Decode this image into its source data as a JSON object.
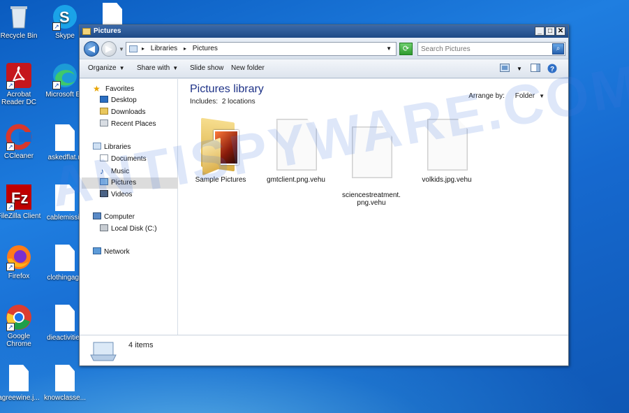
{
  "window": {
    "title": "Pictures",
    "minimize": "_",
    "maximize": "□",
    "close": "✕"
  },
  "address": {
    "crumbs": [
      "Libraries",
      "Pictures"
    ],
    "search_placeholder": "Search Pictures"
  },
  "toolbar": {
    "organize": "Organize",
    "share_with": "Share with",
    "slide_show": "Slide show",
    "new_folder": "New folder"
  },
  "navpane": {
    "favorites": "Favorites",
    "desktop": "Desktop",
    "downloads": "Downloads",
    "recent_places": "Recent Places",
    "libraries": "Libraries",
    "documents": "Documents",
    "music": "Music",
    "pictures": "Pictures",
    "videos": "Videos",
    "computer": "Computer",
    "local_disk": "Local Disk (C:)",
    "network": "Network"
  },
  "content": {
    "title": "Pictures library",
    "includes_label": "Includes:",
    "includes_link": "2 locations",
    "arrange_label": "Arrange by:",
    "arrange_value": "Folder",
    "items": [
      {
        "name": "Sample Pictures",
        "type": "folder"
      },
      {
        "name": "gmtclient.png.vehu",
        "type": "file"
      },
      {
        "name": "sciencestreatment.\npng.vehu",
        "type": "file"
      },
      {
        "name": "volkids.jpg.vehu",
        "type": "file"
      }
    ]
  },
  "details": {
    "count": "4 items"
  },
  "desktop_icons": [
    {
      "label": "Recycle Bin",
      "icon": "recycle-bin-icon"
    },
    {
      "label": "Skype",
      "icon": "skype-icon"
    },
    {
      "label": "Acrobat Reader DC",
      "icon": "acrobat-icon"
    },
    {
      "label": "Microsoft Ed",
      "icon": "edge-icon"
    },
    {
      "label": "CCleaner",
      "icon": "ccleaner-icon"
    },
    {
      "label": "askedflat.rt",
      "icon": "document-icon"
    },
    {
      "label": "FileZilla Client",
      "icon": "filezilla-icon"
    },
    {
      "label": "cablemissio",
      "icon": "document-icon"
    },
    {
      "label": "Firefox",
      "icon": "firefox-icon"
    },
    {
      "label": "clothingage",
      "icon": "document-icon"
    },
    {
      "label": "Google Chrome",
      "icon": "chrome-icon"
    },
    {
      "label": "dieactivities",
      "icon": "document-icon"
    },
    {
      "label": "agreewine.j...",
      "icon": "document-icon"
    },
    {
      "label": "knowclasse...",
      "icon": "document-icon"
    }
  ],
  "watermark": "ANTISPYWARE.COM",
  "colors": {
    "desktop_blue": "#1669cf",
    "title_blue": "#1e4a86",
    "library_title": "#1e3287"
  }
}
